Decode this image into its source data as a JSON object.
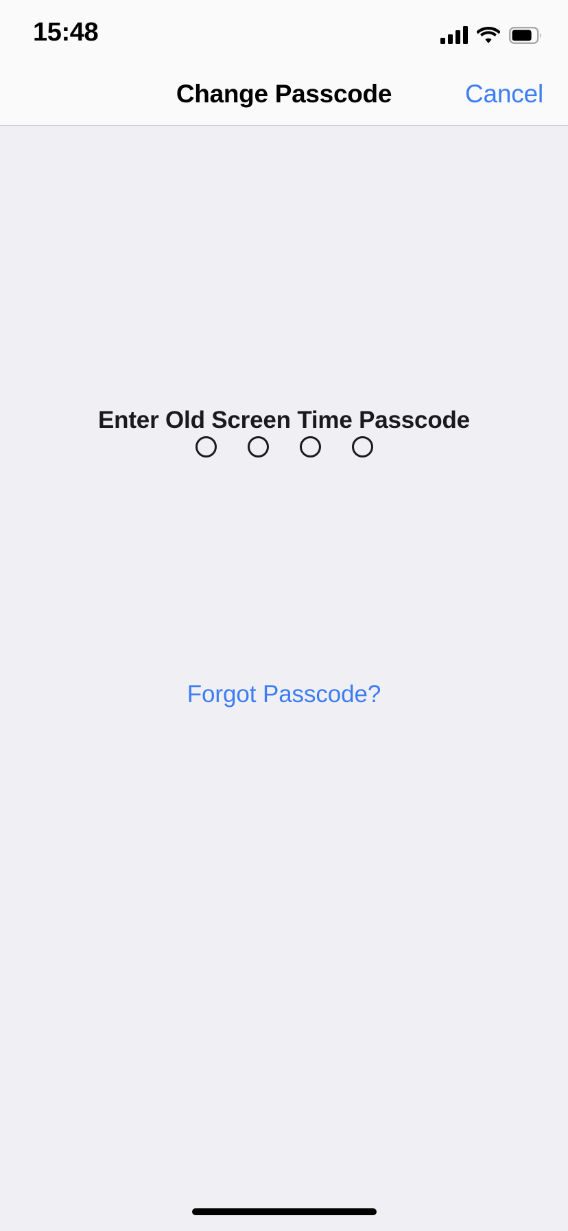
{
  "status_bar": {
    "time": "15:48",
    "cellular_icon": "cellular-bars-icon",
    "cellular_bars_filled": 4,
    "cellular_bars_total": 4,
    "wifi_icon": "wifi-icon",
    "wifi_strength": "full",
    "battery_icon": "battery-icon",
    "battery_level_percent": 82
  },
  "nav_bar": {
    "title": "Change Passcode",
    "cancel_label": "Cancel",
    "accent_color": "#3C7DF4",
    "background_color": "#FAFAFA",
    "separator_color": "#C8C7CC"
  },
  "main": {
    "prompt": "Enter Old Screen Time Passcode",
    "passcode": {
      "length": 4,
      "entered": 0,
      "dots": [
        {
          "filled": false
        },
        {
          "filled": false
        },
        {
          "filled": false
        },
        {
          "filled": false
        }
      ]
    },
    "forgot_passcode_label": "Forgot Passcode?",
    "background_color": "#F0EFF4",
    "text_color": "#1A1A1C"
  },
  "home_indicator": {
    "name": "home-indicator",
    "color": "#000000"
  }
}
